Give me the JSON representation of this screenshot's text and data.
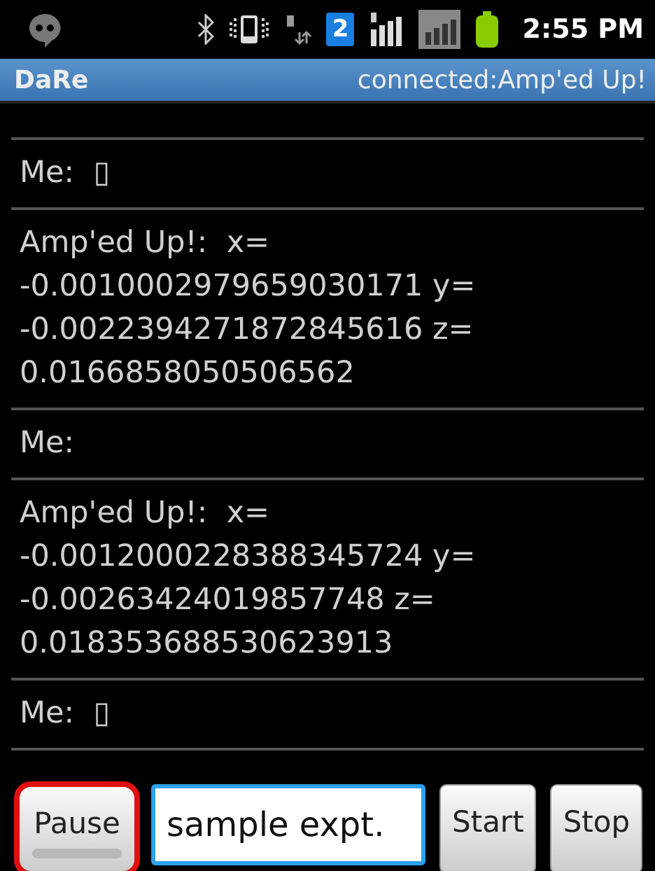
{
  "status_bar": {
    "time": "2:55 PM",
    "network_badge": "2"
  },
  "title_bar": {
    "title": "DaRe",
    "status": "connected:Amp'ed Up!"
  },
  "messages": [
    {
      "text": "Me:  ▯"
    },
    {
      "text": "Amp'ed Up!:  x= -0.0010002979659030171 y= -0.0022394271872845616 z= 0.0166858050506562"
    },
    {
      "text": "Me:"
    },
    {
      "text": "Amp'ed Up!:  x= -0.0012000228388345724 y= -0.00263424019857748 z= 0.018353688530623913"
    },
    {
      "text": "Me:  ▯"
    }
  ],
  "controls": [
    {
      "kind": "toggle",
      "label": "Pause",
      "checked": false,
      "highlighted": true
    },
    {
      "kind": "field",
      "value": "sample expt."
    },
    {
      "kind": "button",
      "label": "Start"
    },
    {
      "kind": "button",
      "label": "Stop"
    }
  ]
}
